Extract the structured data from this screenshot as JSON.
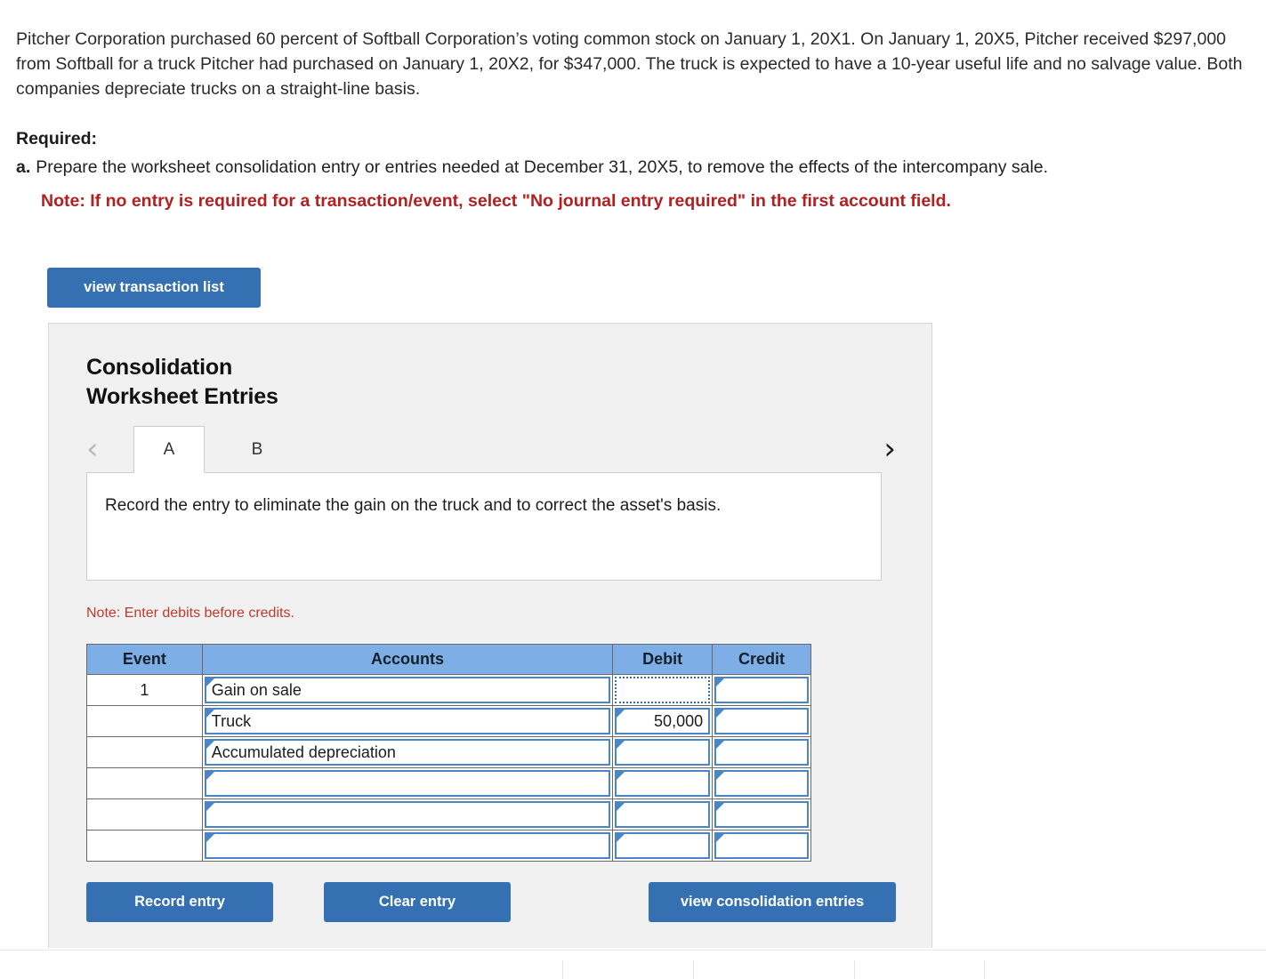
{
  "problem": {
    "paragraph": "Pitcher Corporation purchased 60 percent of Softball Corporation’s voting common stock on January 1, 20X1. On January 1, 20X5, Pitcher received $297,000 from Softball for a truck Pitcher had purchased on January 1, 20X2, for $347,000. The truck is expected to have a 10-year useful life and no salvage value. Both companies depreciate trucks on a straight-line basis."
  },
  "required": {
    "title": "Required:",
    "items": [
      {
        "letter": "a.",
        "text": "Prepare the worksheet consolidation entry or entries needed at December 31, 20X5, to remove the effects of the intercompany sale."
      }
    ],
    "note": "Note: If no entry is required for a transaction/event, select \"No journal entry required\" in the first account field."
  },
  "toolbar": {
    "view_transaction_list_label": "view transaction list"
  },
  "panel": {
    "title_line1": "Consolidation",
    "title_line2": "Worksheet Entries",
    "nav": {
      "prev_icon": "‹",
      "next_icon": "›"
    },
    "tabs": [
      {
        "label": "A",
        "active": true
      },
      {
        "label": "B",
        "active": false
      }
    ],
    "instruction": "Record the entry to eliminate the gain on the truck and to correct the asset's basis.",
    "note_debits": "Note: Enter debits before credits."
  },
  "journal": {
    "columns": [
      "Event",
      "Accounts",
      "Debit",
      "Credit"
    ],
    "rows": [
      {
        "event": "1",
        "account": "Gain on sale",
        "debit": "",
        "credit": "",
        "debit_focused": true
      },
      {
        "event": "",
        "account": "Truck",
        "debit": "50,000",
        "credit": "",
        "debit_focused": false
      },
      {
        "event": "",
        "account": "Accumulated depreciation",
        "debit": "",
        "credit": "",
        "debit_focused": false
      },
      {
        "event": "",
        "account": "",
        "debit": "",
        "credit": "",
        "debit_focused": false
      },
      {
        "event": "",
        "account": "",
        "debit": "",
        "credit": "",
        "debit_focused": false
      },
      {
        "event": "",
        "account": "",
        "debit": "",
        "credit": "",
        "debit_focused": false
      }
    ]
  },
  "actions": {
    "record_entry_label": "Record entry",
    "clear_entry_label": "Clear entry",
    "view_consolidation_entries_label": "view consolidation entries"
  },
  "colors": {
    "button_blue": "#3570b3",
    "table_header_blue": "#7daee5",
    "cell_border_blue": "#4a86c5",
    "note_red": "#b32020",
    "panel_grey": "#f1f1f1"
  }
}
